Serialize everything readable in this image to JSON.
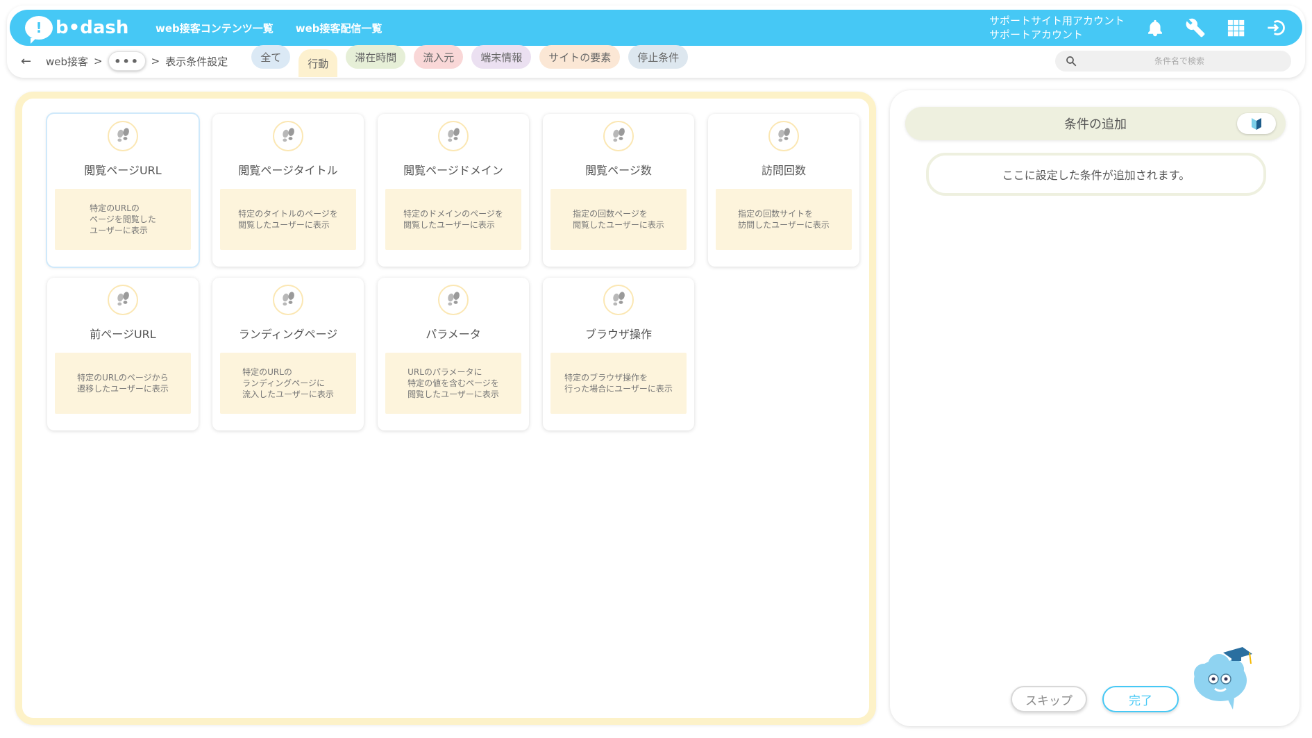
{
  "header": {
    "logo_text": "b•dash",
    "nav": [
      {
        "label": "web接客コンテンツ一覧"
      },
      {
        "label": "web接客配信一覧"
      }
    ],
    "account_line1": "サポートサイト用アカウント",
    "account_line2": "サポートアカウント",
    "icons": [
      "bell-icon",
      "wrench-icon",
      "grid-icon",
      "logout-icon"
    ]
  },
  "breadcrumb": {
    "back_icon": "←",
    "root": "web接客",
    "sep": ">",
    "more": "•••",
    "current": "表示条件設定"
  },
  "filters": [
    {
      "label": "全て",
      "color": "#dbe9f5"
    },
    {
      "label": "行動",
      "color": "#fdf1cf"
    },
    {
      "label": "滞在時間",
      "color": "#e6efd7"
    },
    {
      "label": "流入元",
      "color": "#f9d7d7"
    },
    {
      "label": "端末情報",
      "color": "#ebe0f1"
    },
    {
      "label": "サイトの要素",
      "color": "#fbe7d5"
    },
    {
      "label": "停止条件",
      "color": "#dde7ef"
    }
  ],
  "active_filter": "行動",
  "search": {
    "placeholder": "条件名で検索"
  },
  "cards": [
    {
      "title": "閲覧ページURL",
      "desc": "特定のURLの\nページを閲覧した\nユーザーに表示",
      "selected": true
    },
    {
      "title": "閲覧ページタイトル",
      "desc": "特定のタイトルのページを\n閲覧したユーザーに表示",
      "selected": false
    },
    {
      "title": "閲覧ページドメイン",
      "desc": "特定のドメインのページを\n閲覧したユーザーに表示",
      "selected": false
    },
    {
      "title": "閲覧ページ数",
      "desc": "指定の回数ページを\n閲覧したユーザーに表示",
      "selected": false
    },
    {
      "title": "訪問回数",
      "desc": "指定の回数サイトを\n訪問したユーザーに表示",
      "selected": false
    },
    {
      "title": "前ページURL",
      "desc": "特定のURLのページから\n遷移したユーザーに表示",
      "selected": false
    },
    {
      "title": "ランディングページ",
      "desc": "特定のURLの\nランディングページに\n流入したユーザーに表示",
      "selected": false
    },
    {
      "title": "パラメータ",
      "desc": "URLのパラメータに\n特定の値を含むページを\n閲覧したユーザーに表示",
      "selected": false
    },
    {
      "title": "ブラウザ操作",
      "desc": "特定のブラウザ操作を\n行った場合にユーザーに表示",
      "selected": false
    }
  ],
  "right_panel": {
    "add_condition_label": "条件の追加",
    "placeholder_text": "ここに設定した条件が追加されます。",
    "skip_label": "スキップ",
    "done_label": "完了"
  },
  "colors": {
    "brand": "#46c8f5",
    "panel_border": "#fdf2c8",
    "desc_bg": "#fdf4dc"
  }
}
